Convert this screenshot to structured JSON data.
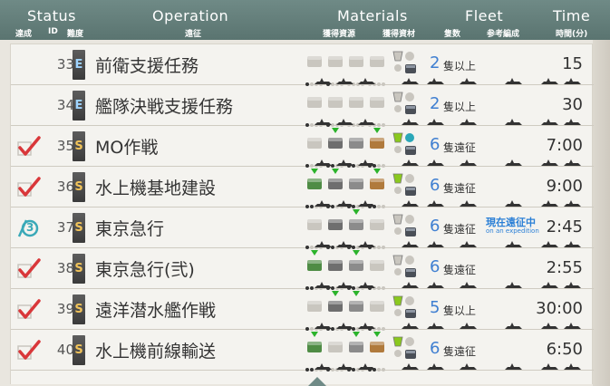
{
  "header": {
    "status_en": "Status",
    "operation_en": "Operation",
    "materials_en": "Materials",
    "fleet_en": "Fleet",
    "time_en": "Time",
    "achieved_jp": "達成",
    "id_jp": "ID",
    "difficulty_jp": "難度",
    "expedition_jp": "遠征",
    "resources_jp": "獲得資源",
    "materials_jp": "獲得資材",
    "ship_count_jp": "隻数",
    "ref_fleet_jp": "参考編成",
    "time_jp": "時間(分)"
  },
  "colors": {
    "header_bg": "#6f8a86",
    "fleet_number": "#3f7fd1",
    "check": "#d9373a",
    "difficulty_s": "#f2c45a",
    "difficulty_e": "#9fd4ff",
    "bonus_triangle": "#2bb32b"
  },
  "rows": [
    {
      "id": "33",
      "difficulty": "E",
      "name": "前衛支援任務",
      "status": "none",
      "fleet_num": "2",
      "fleet_text": "隻以上",
      "time": "15",
      "expedition_status": "",
      "expedition_status_en": ""
    },
    {
      "id": "34",
      "difficulty": "E",
      "name": "艦隊決戦支援任務",
      "status": "none",
      "fleet_num": "2",
      "fleet_text": "隻以上",
      "time": "30",
      "expedition_status": "",
      "expedition_status_en": ""
    },
    {
      "id": "35",
      "difficulty": "S",
      "name": "MO作戦",
      "status": "complete",
      "fleet_num": "6",
      "fleet_text": "隻遠征",
      "time": "7:00",
      "expedition_status": "",
      "expedition_status_en": ""
    },
    {
      "id": "36",
      "difficulty": "S",
      "name": "水上機基地建設",
      "status": "complete",
      "fleet_num": "6",
      "fleet_text": "隻遠征",
      "time": "9:00",
      "expedition_status": "",
      "expedition_status_en": ""
    },
    {
      "id": "37",
      "difficulty": "S",
      "name": "東京急行",
      "status": "progress",
      "progress_label": "3",
      "fleet_num": "6",
      "fleet_text": "隻遠征",
      "time": "2:45",
      "expedition_status": "現在遠征中",
      "expedition_status_en": "on an expedition"
    },
    {
      "id": "38",
      "difficulty": "S",
      "name": "東京急行(弐)",
      "status": "complete",
      "fleet_num": "6",
      "fleet_text": "隻遠征",
      "time": "2:55",
      "expedition_status": "",
      "expedition_status_en": ""
    },
    {
      "id": "39",
      "difficulty": "S",
      "name": "遠洋潜水艦作戦",
      "status": "complete",
      "fleet_num": "5",
      "fleet_text": "隻以上",
      "time": "30:00",
      "expedition_status": "",
      "expedition_status_en": ""
    },
    {
      "id": "40",
      "difficulty": "S",
      "name": "水上機前線輸送",
      "status": "complete",
      "fleet_num": "6",
      "fleet_text": "隻遠征",
      "time": "6:50",
      "expedition_status": "",
      "expedition_status_en": ""
    }
  ],
  "icons": {
    "fuel": "fuel-icon",
    "ammo": "ammo-icon",
    "steel": "steel-icon",
    "bauxite": "bauxite-icon",
    "bucket": "bucket-icon",
    "devmat": "devmat-icon",
    "check": "check-icon",
    "ship": "ship-silhouette-icon"
  }
}
